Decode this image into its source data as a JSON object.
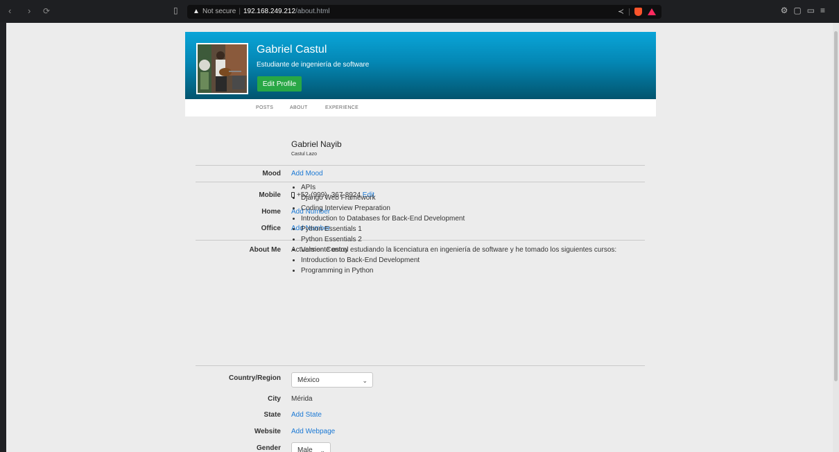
{
  "browser": {
    "security_label": "Not secure",
    "url_host": "192.168.249.212",
    "url_path": "/about.html"
  },
  "profile": {
    "name": "Gabriel Castul",
    "subtitle": "Estudiante de ingeniería de software",
    "edit_button": "Edit Profile"
  },
  "tabs": [
    "POSTS",
    "ABOUT",
    "EXPERIENCE"
  ],
  "about": {
    "first_name": "Gabriel Nayib",
    "last_name": "Castul Lazo",
    "mood_label": "Mood",
    "mood_link": "Add Mood",
    "mobile_label": "Mobile",
    "mobile_value": "+52-(999)- 367-8924",
    "mobile_edit": "Edit",
    "home_label": "Home",
    "home_link": "Add Number",
    "office_label": "Office",
    "office_link": "Add Number",
    "aboutme_label": "About Me",
    "aboutme_text": "Actualmente estoy estudiando la licenciatura en ingeniería de software y he tomado los siguientes cursos:",
    "courses": [
      "APIs",
      "Django Web Framework",
      "Coding Interview Preparation",
      "Introduction to Databases for Back-End Development",
      "Python Essentials 1",
      "Python Essentials 2",
      "Version Control",
      "Introduction to Back-End Development",
      "Programming in Python"
    ],
    "country_label": "Country/Region",
    "country_value": "México",
    "city_label": "City",
    "city_value": "Mérida",
    "state_label": "State",
    "state_link": "Add State",
    "website_label": "Website",
    "website_link": "Add Webpage",
    "gender_label": "Gender",
    "gender_value": "Male"
  },
  "icons": {
    "back": "chevron-left-icon",
    "forward": "chevron-right-icon",
    "reload": "reload-icon",
    "bookmark": "bookmark-icon",
    "warning": "warning-icon",
    "share": "share-icon",
    "phone": "phone-icon",
    "dropdown": "chevron-down-icon"
  },
  "colors": {
    "banner_top": "#0aa5d8",
    "banner_bottom": "#02546e",
    "edit_button": "#28a745",
    "link": "#1a78d4"
  }
}
